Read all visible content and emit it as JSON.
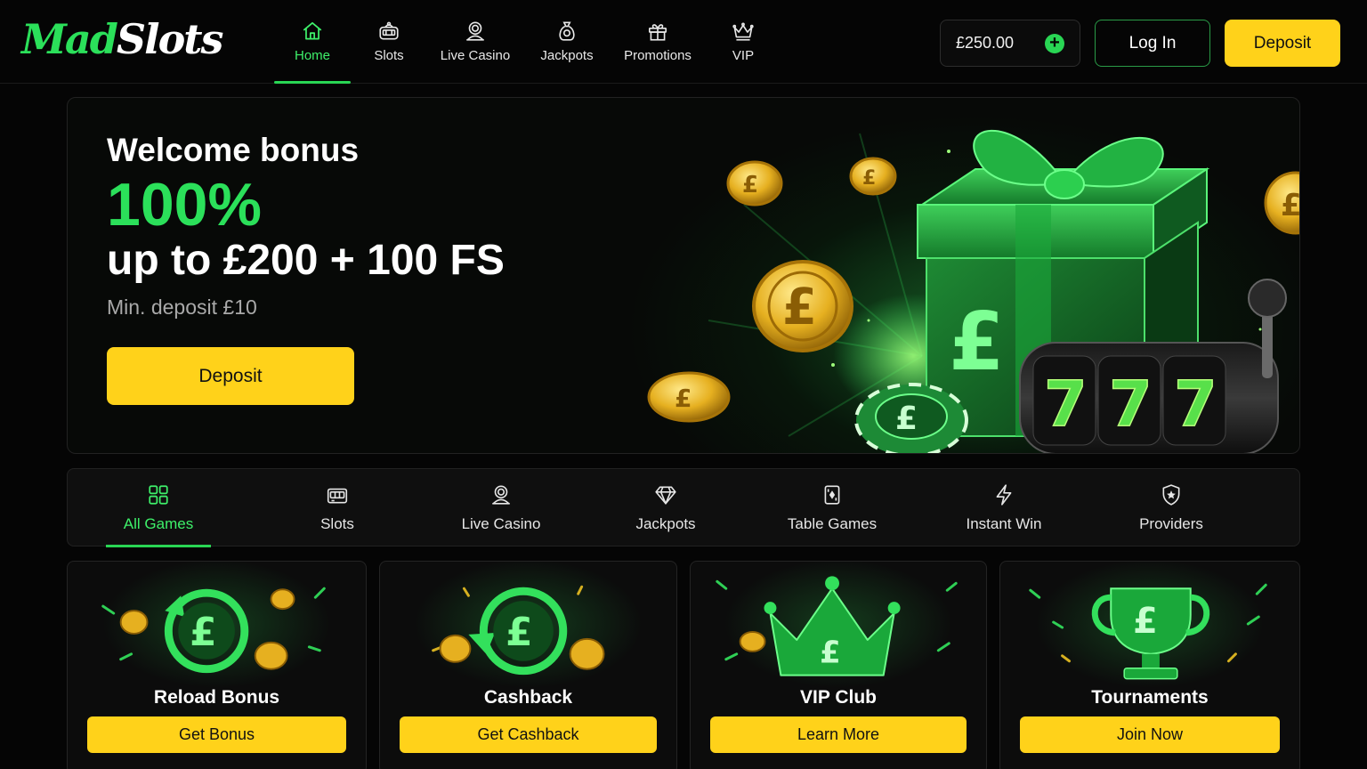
{
  "brand": {
    "logo_part1": "Mad",
    "logo_part2": "Slots"
  },
  "colors": {
    "accent_green": "#29d654",
    "accent_yellow": "#ffd21a",
    "background": "#050505"
  },
  "nav": {
    "items": [
      {
        "label": "Home",
        "icon": "home-icon",
        "active": true
      },
      {
        "label": "Slots",
        "icon": "slot-machine-icon"
      },
      {
        "label": "Live Casino",
        "icon": "dealer-icon"
      },
      {
        "label": "Jackpots",
        "icon": "money-bag-icon"
      },
      {
        "label": "Promotions",
        "icon": "gift-icon"
      },
      {
        "label": "VIP",
        "icon": "crown-icon"
      }
    ]
  },
  "account": {
    "balance": "£250.00",
    "add_funds_symbol": "+",
    "login_label": "Log In",
    "deposit_label": "Deposit"
  },
  "hero": {
    "title": "Welcome bonus",
    "percentage": "100%",
    "offer": "up to £200 + 100 FS",
    "min_deposit": "Min. deposit £10",
    "button_label": "Deposit",
    "art_symbols": {
      "pound": "£",
      "reel": "7"
    }
  },
  "categories": {
    "items": [
      {
        "label": "All Games",
        "icon": "grid-icon",
        "active": true
      },
      {
        "label": "Slots",
        "icon": "slot-machine-icon"
      },
      {
        "label": "Live Casino",
        "icon": "dealer-icon"
      },
      {
        "label": "Jackpots",
        "icon": "diamond-icon"
      },
      {
        "label": "Table Games",
        "icon": "cards-icon"
      },
      {
        "label": "Instant Win",
        "icon": "lightning-icon"
      },
      {
        "label": "Providers",
        "icon": "shield-star-icon"
      }
    ]
  },
  "promos": [
    {
      "title": "Reload Bonus",
      "button": "Get Bonus",
      "icon": "reload-pound-icon"
    },
    {
      "title": "Cashback",
      "button": "Get Cashback",
      "icon": "cashback-pound-icon"
    },
    {
      "title": "VIP Club",
      "button": "Learn More",
      "icon": "crown-pound-icon"
    },
    {
      "title": "Tournaments",
      "button": "Join Now",
      "icon": "trophy-pound-icon"
    }
  ]
}
